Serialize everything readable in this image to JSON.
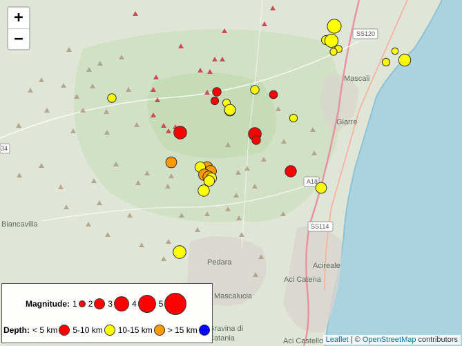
{
  "map": {
    "places": [
      {
        "name": "Mascali"
      },
      {
        "name": "Giarre"
      },
      {
        "name": "Biancavilla"
      },
      {
        "name": "Pedara"
      },
      {
        "name": "Acireale"
      },
      {
        "name": "Aci Catena"
      },
      {
        "name": "Mascalucia"
      },
      {
        "name": "Gravina di"
      },
      {
        "name": "Catania"
      },
      {
        "name": "Aci Castello"
      }
    ],
    "roads": [
      "SS120",
      "A18",
      "SS114",
      "34"
    ],
    "colors": {
      "land": "#dfe6d7",
      "sea": "#aad3df",
      "volcano": "#bcd8ad",
      "shallow": "#ff0000",
      "mid": "#ffff00",
      "deep": "#ff9900",
      "deepest": "#0000ff"
    }
  },
  "zoom": {
    "in_label": "+",
    "out_label": "−"
  },
  "legend": {
    "magnitude_title": "Magnitude:",
    "magnitudes": [
      "1",
      "2",
      "3",
      "4",
      "5"
    ],
    "depth_title": "Depth:",
    "depths": [
      "< 5 km",
      "5-10 km",
      "10-15 km",
      "> 15 km"
    ]
  },
  "attribution": {
    "leaflet": "Leaflet",
    "sep": " | © ",
    "osm": "OpenStreetMap",
    "suffix": " contributors"
  },
  "events": [
    {
      "mag": 2.9,
      "depth": "mid"
    },
    {
      "mag": 1.6,
      "depth": "mid"
    },
    {
      "mag": 2.7,
      "depth": "mid"
    },
    {
      "mag": 1.2,
      "depth": "mid"
    },
    {
      "mag": 1.1,
      "depth": "mid"
    },
    {
      "mag": 1.0,
      "depth": "mid"
    },
    {
      "mag": 2.4,
      "depth": "mid"
    },
    {
      "mag": 1.3,
      "depth": "mid"
    },
    {
      "mag": 1.5,
      "depth": "mid"
    },
    {
      "mag": 1.5,
      "depth": "shallow"
    },
    {
      "mag": 1.3,
      "depth": "shallow"
    },
    {
      "mag": 1.5,
      "depth": "mid"
    },
    {
      "mag": 2.1,
      "depth": "mid"
    },
    {
      "mag": 1.4,
      "depth": "shallow"
    },
    {
      "mag": 1.3,
      "depth": "mid"
    },
    {
      "mag": 1.3,
      "depth": "mid"
    },
    {
      "mag": 2.6,
      "depth": "shallow"
    },
    {
      "mag": 2.6,
      "depth": "shallow"
    },
    {
      "mag": 1.5,
      "depth": "shallow"
    },
    {
      "mag": 2.1,
      "depth": "deep"
    },
    {
      "mag": 2.1,
      "depth": "deep"
    },
    {
      "mag": 2.3,
      "depth": "deep"
    },
    {
      "mag": 2.0,
      "depth": "mid"
    },
    {
      "mag": 2.3,
      "depth": "deep"
    },
    {
      "mag": 2.2,
      "depth": "deep"
    },
    {
      "mag": 2.0,
      "depth": "mid"
    },
    {
      "mag": 2.0,
      "depth": "mid"
    },
    {
      "mag": 2.2,
      "depth": "mid"
    },
    {
      "mag": 2.1,
      "depth": "mid"
    },
    {
      "mag": 2.2,
      "depth": "shallow"
    },
    {
      "mag": 2.6,
      "depth": "mid"
    },
    {
      "mag": 2.1,
      "depth": "mid"
    }
  ]
}
